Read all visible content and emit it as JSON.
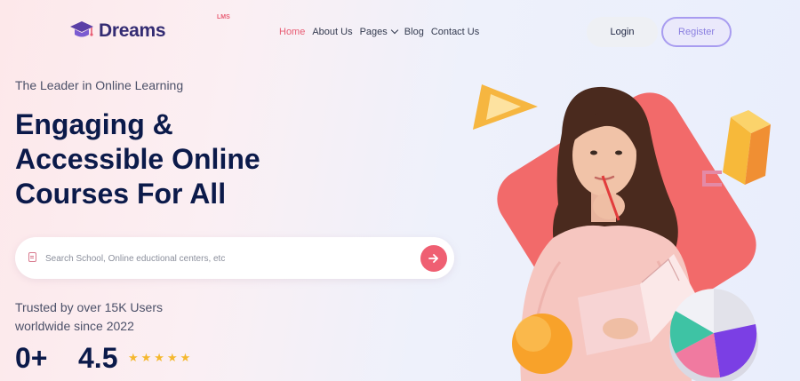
{
  "header": {
    "logo_text": "Dreams",
    "logo_superscript": "LMS",
    "nav": [
      {
        "label": "Home",
        "active": true
      },
      {
        "label": "About Us",
        "active": false
      },
      {
        "label": "Pages",
        "active": false,
        "has_dropdown": true
      },
      {
        "label": "Blog",
        "active": false
      },
      {
        "label": "Contact Us",
        "active": false
      }
    ],
    "login_label": "Login",
    "register_label": "Register"
  },
  "hero": {
    "tagline": "The Leader in Online Learning",
    "headline_line1": "Engaging &",
    "headline_line2": "Accessible Online",
    "headline_line3": "Courses For All"
  },
  "search": {
    "placeholder": "Search School, Online eductional centers, etc",
    "icon": "document-icon",
    "button_icon": "arrow-right-icon"
  },
  "trust": {
    "line1": "Trusted by over 15K Users",
    "line2": "worldwide since 2022"
  },
  "stats": {
    "stat1_value": "0+",
    "stat2_value": "4.5",
    "rating_stars": 5,
    "stars_text": "★★★★★"
  },
  "colors": {
    "accent": "#ef5f72",
    "navy": "#0b1a4a",
    "brand_purple": "#342c73",
    "register_border": "#a89cf0",
    "star": "#f5b82e"
  }
}
